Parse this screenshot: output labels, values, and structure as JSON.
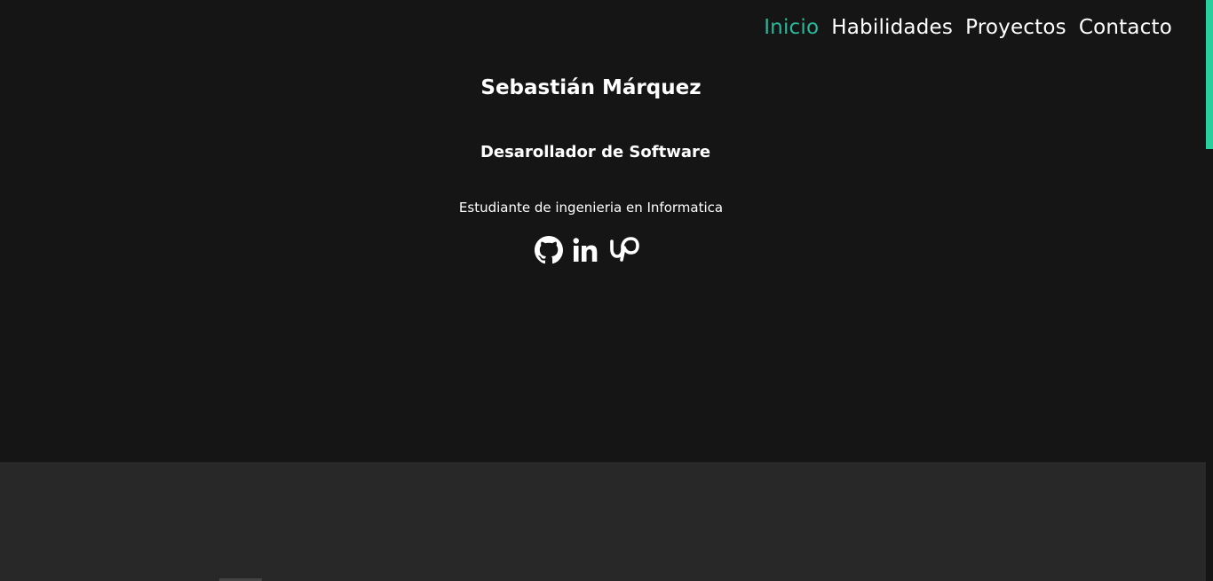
{
  "nav": {
    "items": [
      {
        "label": "Inicio",
        "active": true
      },
      {
        "label": "Habilidades",
        "active": false
      },
      {
        "label": "Proyectos",
        "active": false
      },
      {
        "label": "Contacto",
        "active": false
      }
    ]
  },
  "hero": {
    "name": "Sebastián Márquez",
    "role": "Desarollador de Software",
    "subtitle": "Estudiante de ingenieria en Informatica"
  },
  "socials": [
    {
      "icon": "github-icon"
    },
    {
      "icon": "linkedin-icon"
    },
    {
      "icon": "upwork-icon"
    }
  ],
  "colors": {
    "accent": "#29b89a",
    "background": "#151515",
    "section_background": "#282828",
    "scrollbar": "#29cf9d",
    "text": "#ffffff"
  }
}
